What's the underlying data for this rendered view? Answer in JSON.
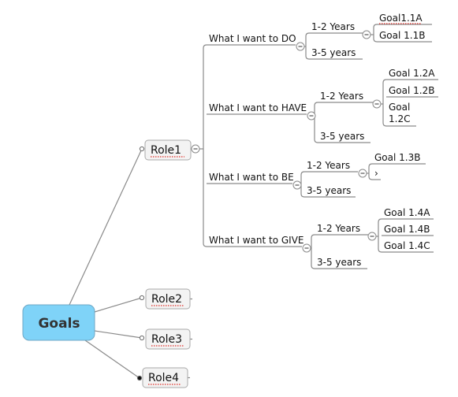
{
  "central": {
    "label": "Goals",
    "color": "#7fd3f8",
    "border": "#6fa7c4"
  },
  "roles": [
    {
      "label": "Role1",
      "expanded": true,
      "spellcheck": true
    },
    {
      "label": "Role2",
      "expanded": false,
      "spellcheck": true
    },
    {
      "label": "Role3",
      "expanded": false,
      "spellcheck": true
    },
    {
      "label": "Role4",
      "expanded": false,
      "spellcheck": true
    }
  ],
  "branches": [
    {
      "label": "What I want to DO",
      "children": [
        {
          "label": "1-2 Years",
          "goals": [
            "Goal1.1A",
            "Goal 1.1B"
          ]
        },
        {
          "label": "3-5 years",
          "goals": []
        }
      ]
    },
    {
      "label": "What I want to HAVE",
      "children": [
        {
          "label": "1-2 Years",
          "goals": [
            "Goal 1.2A",
            "Goal 1.2B",
            "Goal\n1.2C"
          ]
        },
        {
          "label": "3-5 years",
          "goals": []
        }
      ]
    },
    {
      "label": "What I want to BE",
      "children": [
        {
          "label": "1-2 Years",
          "goals": [
            "Goal 1.3B",
            "›"
          ]
        },
        {
          "label": "3-5 years",
          "goals": []
        }
      ]
    },
    {
      "label": "What I want to GIVE",
      "children": [
        {
          "label": "1-2 Years",
          "goals": [
            "Goal 1.4A",
            "Goal 1.4B",
            "Goal 1.4C"
          ]
        },
        {
          "label": "3-5 years",
          "goals": []
        }
      ]
    }
  ],
  "icons": {
    "collapse": "collapse-minus-icon"
  }
}
